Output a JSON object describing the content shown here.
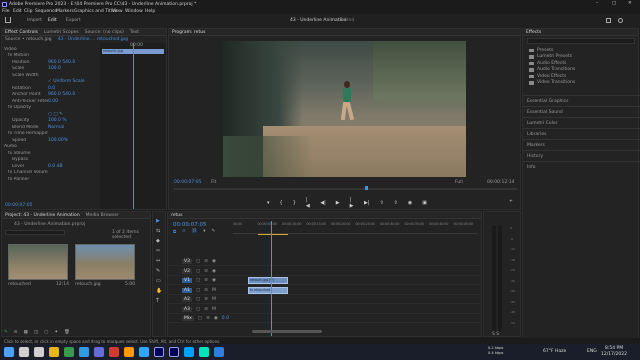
{
  "app": {
    "title": "Adobe Premiere Pro 2023 - E:\\04 Premiere Pro CC\\43 - Underline Animation.prproj *"
  },
  "window_controls": {
    "minimize": "–",
    "maximize": "□",
    "close": "✕"
  },
  "menu": [
    "File",
    "Edit",
    "Clip",
    "Sequence",
    "Markers",
    "Graphics and Titles",
    "View",
    "Window",
    "Help"
  ],
  "workspace_tabs": {
    "import": "Import",
    "edit": "Edit",
    "export": "Export"
  },
  "program_header": {
    "name": "43 - Underline Animation",
    "status": "Edited"
  },
  "effect_controls": {
    "tabs": [
      "Effect Controls",
      "Lumetri Scopes",
      "Source: (no clips)",
      "Text"
    ],
    "source": "Source • retouch.jpg",
    "clip": "43 - Underline ... retouched.jpg",
    "mini_timecode": "00:00",
    "clip_bar": "retouch.jpg",
    "rows": [
      {
        "name": "Video",
        "value": "",
        "indent": 0
      },
      {
        "name": "fx Motion",
        "value": "",
        "indent": 1
      },
      {
        "name": "Position",
        "value": "960.0   540.0",
        "indent": 2
      },
      {
        "name": "Scale",
        "value": "100.0",
        "indent": 2
      },
      {
        "name": "Scale Width",
        "value": "",
        "indent": 2
      },
      {
        "name": "",
        "value": "✓ Uniform Scale",
        "indent": 2
      },
      {
        "name": "Rotation",
        "value": "0.0",
        "indent": 2
      },
      {
        "name": "Anchor Point",
        "value": "960.0   540.0",
        "indent": 2
      },
      {
        "name": "Anti-flicker Filter",
        "value": "0.00",
        "indent": 2
      },
      {
        "name": "fx Opacity",
        "value": "",
        "indent": 1
      },
      {
        "name": "",
        "value": "○ □ ✎",
        "indent": 2
      },
      {
        "name": "Opacity",
        "value": "100.0 %",
        "indent": 2
      },
      {
        "name": "Blend Mode",
        "value": "Normal",
        "indent": 2
      },
      {
        "name": "fx Time Remapping",
        "value": "",
        "indent": 1
      },
      {
        "name": "Speed",
        "value": "100.00%",
        "indent": 2
      },
      {
        "name": "Audio",
        "value": "",
        "indent": 0
      },
      {
        "name": "fx Volume",
        "value": "",
        "indent": 1
      },
      {
        "name": "Bypass",
        "value": "",
        "indent": 2
      },
      {
        "name": "Level",
        "value": "0.0 dB",
        "indent": 2
      },
      {
        "name": "fx Channel Volume",
        "value": "",
        "indent": 1
      },
      {
        "name": "fx Panner",
        "value": "",
        "indent": 1
      }
    ],
    "timecode": "00:00:07:05"
  },
  "program": {
    "label": "Program: retus",
    "timecode": "00:00:07:05",
    "fit": "Fit",
    "quality": "Full",
    "duration": "00:00:12:14"
  },
  "project": {
    "tabs": [
      "Project: 43 - Underline Animation",
      "Media Browser"
    ],
    "path": "43 - Underline Animation.prproj",
    "count": "1 of 2 items selected",
    "items": [
      {
        "name": "retouched",
        "dur": "12:14"
      },
      {
        "name": "retouch.jpg",
        "dur": "5:00"
      }
    ]
  },
  "tools": [
    "▶",
    "⇆",
    "◆",
    "✂",
    "↔",
    "✎",
    "▭",
    "✋",
    "T"
  ],
  "timeline": {
    "tab": "retus",
    "timecode": "00:00:07:05",
    "ruler": [
      "00:00",
      "00:00:05:00",
      "00:00:10:00",
      "00:00:15:00",
      "00:00:20:00",
      "00:00:25:00",
      "00:00:30:00",
      "00:00:35:00",
      "00:00:40:00",
      "00:00:45:00"
    ],
    "tracks": [
      {
        "label": "V3",
        "type": "video"
      },
      {
        "label": "V2",
        "type": "video"
      },
      {
        "label": "V1",
        "type": "video"
      },
      {
        "label": "A1",
        "type": "audio"
      },
      {
        "label": "A2",
        "type": "audio"
      },
      {
        "label": "A3",
        "type": "audio"
      },
      {
        "label": "Mix",
        "value": "0.0"
      }
    ],
    "clips": [
      {
        "name": "retouch.jpg [V]",
        "track": "V1"
      },
      {
        "name": "fx retouched",
        "track": "A1"
      }
    ]
  },
  "meter": {
    "scale": [
      "0",
      "-6",
      "-12",
      "-18",
      "-24",
      "-30",
      "-36",
      "-42",
      "-48",
      "-54"
    ],
    "footer": "S S"
  },
  "effects": {
    "title": "Effects",
    "items": [
      "Presets",
      "Lumetri Presets",
      "Audio Effects",
      "Audio Transitions",
      "Video Effects",
      "Video Transitions"
    ],
    "panels": [
      "Essential Graphics",
      "Essential Sound",
      "Lumetri Color",
      "Libraries",
      "Markers",
      "History",
      "Info"
    ]
  },
  "status": "Click to select, or click in empty space and drag to marquee select. Use Shift, Alt, and Ctrl for other options.",
  "taskbar": {
    "apps": [
      {
        "icon": "start-icon",
        "color": "#4aa3ff"
      },
      {
        "icon": "search-icon",
        "color": "#cfcfcf"
      },
      {
        "icon": "taskview-icon",
        "color": "#cfcfcf"
      },
      {
        "icon": "explorer-icon",
        "color": "#e6b422"
      },
      {
        "icon": "chrome-icon",
        "color": "#3a9a4a"
      },
      {
        "icon": "edge-icon",
        "color": "#2f9be0"
      },
      {
        "icon": "store-icon",
        "color": "#6a6ad8"
      },
      {
        "icon": "red-app-icon",
        "color": "#d23c2c"
      },
      {
        "icon": "illustrator-icon",
        "color": "#ff9a00"
      },
      {
        "icon": "photoshop-icon",
        "color": "#31a8ff"
      },
      {
        "icon": "premiere-icon",
        "color": "#9999ff"
      },
      {
        "icon": "aftereffects-icon",
        "color": "#9999ff"
      },
      {
        "icon": "media-encoder-icon",
        "color": "#00a2ff"
      },
      {
        "icon": "audition-icon",
        "color": "#00e4bb"
      },
      {
        "icon": "mail-icon",
        "color": "#2f7de1"
      }
    ],
    "net": "0.2 kbps\n0.4 kbps",
    "weather": "67°F  Haze",
    "lang": "ENG",
    "time": "8:54 PM",
    "date": "12/17/2022"
  }
}
